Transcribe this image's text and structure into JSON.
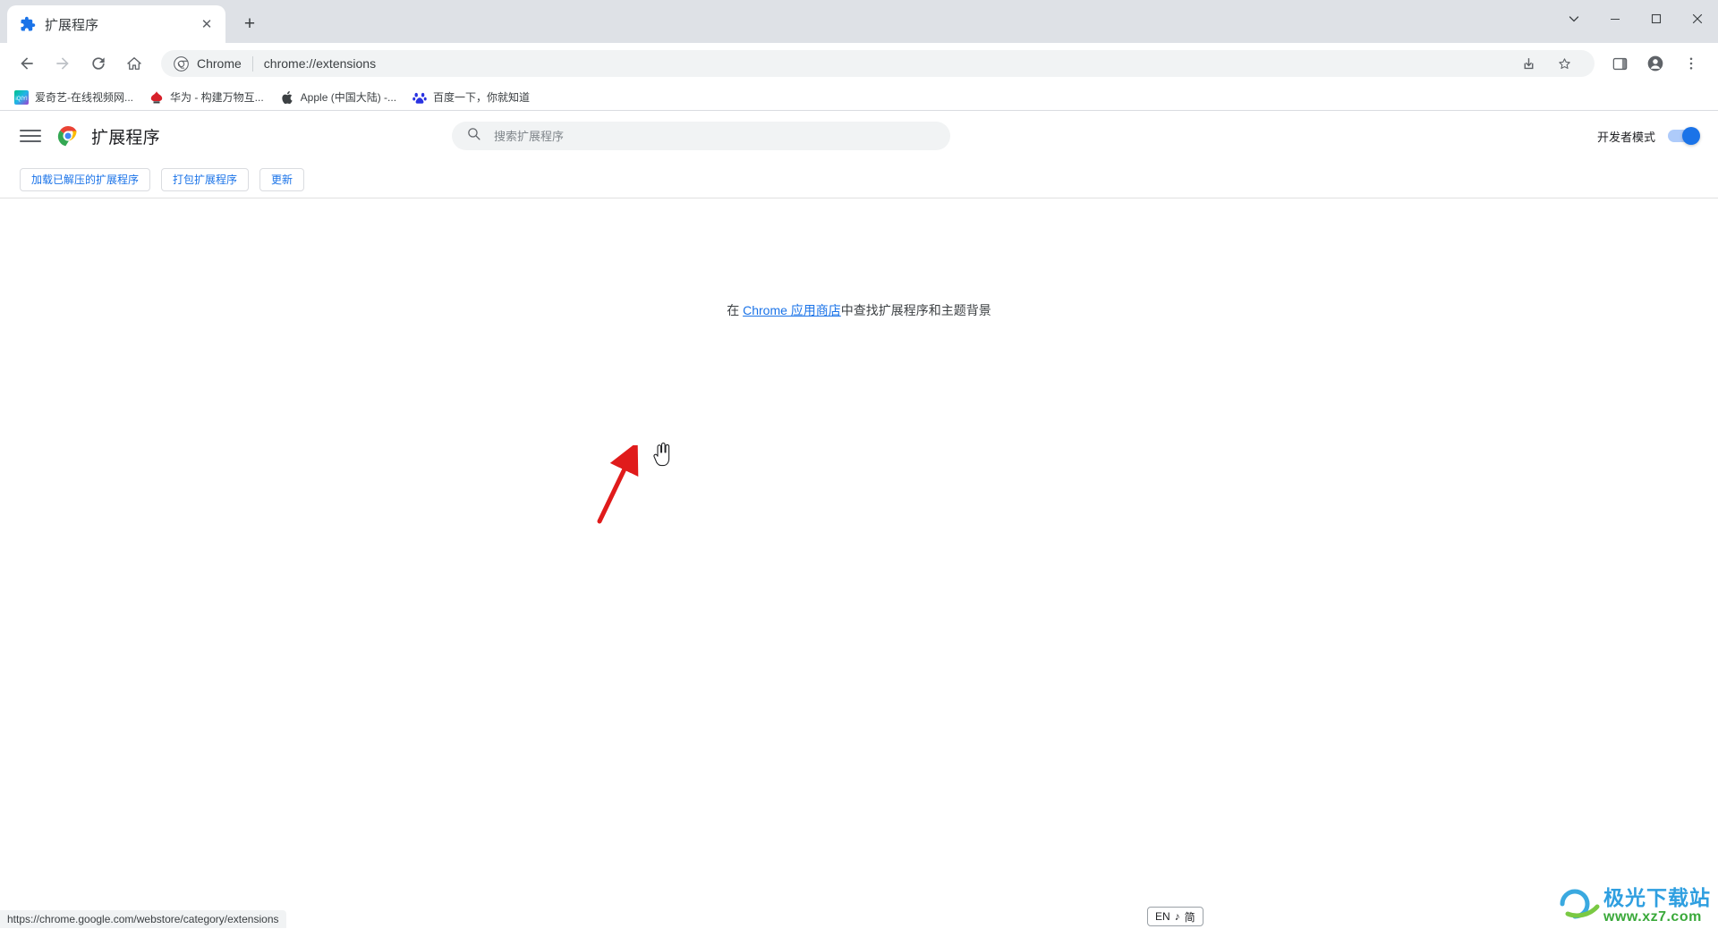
{
  "window": {
    "controls": [
      "minimize-restore-chevron",
      "minimize",
      "maximize",
      "close"
    ]
  },
  "tab": {
    "title": "扩展程序",
    "favicon": "extension-puzzle-icon",
    "close_label": "✕",
    "new_tab_label": "+"
  },
  "toolbar": {
    "back_label": "←",
    "forward_label": "→",
    "reload_label": "⟳",
    "home_label": "⌂",
    "omnibox": {
      "chip_label": "Chrome",
      "url": "chrome://extensions",
      "chip_icon": "chrome-icon"
    },
    "share_label": "share-icon",
    "bookmark_label": "star-icon",
    "sidepanel_label": "side-panel-icon",
    "profile_label": "profile-avatar-icon",
    "menu_label": "⋮"
  },
  "bookmarks": [
    {
      "label": "爱奇艺-在线视频网...",
      "icon": "iqiyi-icon"
    },
    {
      "label": "华为 - 构建万物互...",
      "icon": "huawei-icon"
    },
    {
      "label": "Apple (中国大陆) -...",
      "icon": "apple-icon"
    },
    {
      "label": "百度一下，你就知道",
      "icon": "baidu-icon"
    }
  ],
  "extensions_page": {
    "menu_button": "hamburger-menu",
    "logo": "chrome-logo",
    "title": "扩展程序",
    "search": {
      "placeholder": "搜索扩展程序",
      "value": "",
      "icon": "search-icon"
    },
    "developer_mode": {
      "label": "开发者模式",
      "enabled": true
    },
    "actions": [
      {
        "label": "加载已解压的扩展程序"
      },
      {
        "label": "打包扩展程序"
      },
      {
        "label": "更新"
      }
    ],
    "empty_state": {
      "prefix": "在 ",
      "link_text": "Chrome 应用商店",
      "suffix": "中查找扩展程序和主题背景"
    }
  },
  "status_bar": {
    "url": "https://chrome.google.com/webstore/category/extensions"
  },
  "ime_indicator": {
    "language": "EN",
    "mode_icon": "♪",
    "mode": "简"
  },
  "watermark": {
    "title": "极光下载站",
    "url": "www.xz7.com"
  },
  "colors": {
    "accent": "#1a73e8",
    "tabstrip_bg": "#dee1e6",
    "omnibox_bg": "#f1f3f4",
    "toggle_on": "#1a73e8",
    "annotation_arrow": "#e01b1b"
  }
}
